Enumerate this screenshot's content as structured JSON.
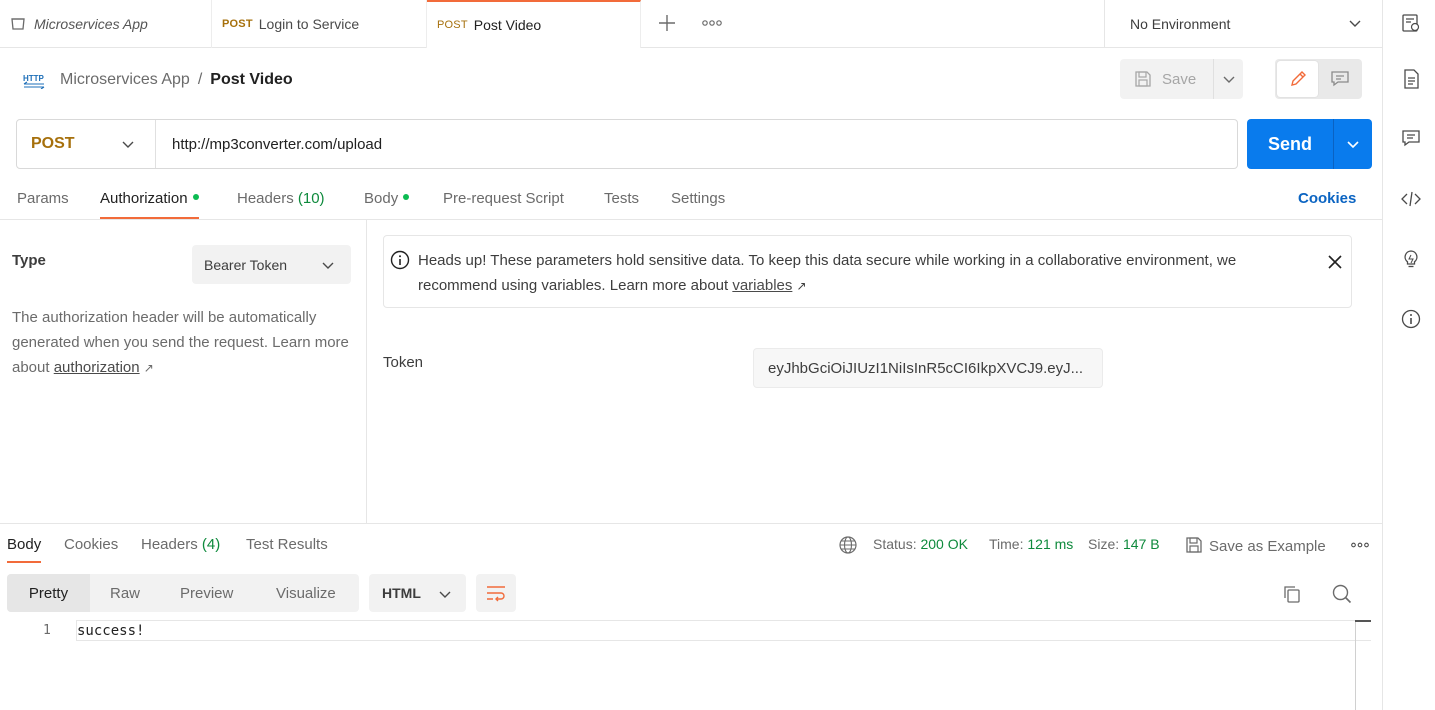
{
  "tabs": [
    {
      "method": "",
      "label": "Microservices App"
    },
    {
      "method": "POST",
      "label": "Login to Service"
    },
    {
      "method": "POST",
      "label": "Post Video"
    }
  ],
  "environment": {
    "selected": "No Environment"
  },
  "breadcrumb": {
    "collection": "Microservices App",
    "separator": "/",
    "request": "Post Video"
  },
  "toolbar": {
    "save_label": "Save"
  },
  "request": {
    "method": "POST",
    "url": "http://mp3converter.com/upload",
    "send_label": "Send"
  },
  "request_tabs": {
    "params": "Params",
    "authorization": "Authorization",
    "headers": "Headers",
    "headers_count": "(10)",
    "body": "Body",
    "prerequest": "Pre-request Script",
    "tests": "Tests",
    "settings": "Settings",
    "cookies": "Cookies"
  },
  "auth": {
    "type_label": "Type",
    "type_value": "Bearer Token",
    "desc_text": "The authorization header will be automatically generated when you send the request. Learn more about ",
    "desc_link": "authorization",
    "link_arrow": "↗",
    "notice_text": "Heads up! These parameters hold sensitive data. To keep this data secure while working in a collaborative environment, we recommend using variables. Learn more about ",
    "notice_link": "variables",
    "token_label": "Token",
    "token_value": "eyJhbGciOiJIUzI1NiIsInR5cCI6IkpXVCJ9.eyJ..."
  },
  "response": {
    "tabs": {
      "body": "Body",
      "cookies": "Cookies",
      "headers": "Headers",
      "headers_count": "(4)",
      "tests": "Test Results"
    },
    "status_label": "Status:",
    "status_value": "200 OK",
    "time_label": "Time:",
    "time_value": "121 ms",
    "size_label": "Size:",
    "size_value": "147 B",
    "save_example": "Save as Example",
    "views": [
      "Pretty",
      "Raw",
      "Preview",
      "Visualize"
    ],
    "format": "HTML",
    "line_number": "1",
    "body_text": "success!"
  },
  "colors": {
    "accent": "#f26b3a",
    "send": "#097bed",
    "method": "#a6700c",
    "ok": "#0e8a3c",
    "link": "#0b64c2"
  },
  "icons": [
    "collection-icon",
    "plus-icon",
    "more-icon",
    "chevron-down-icon",
    "http-icon",
    "save-icon",
    "pencil-icon",
    "comment-icon",
    "info-icon",
    "close-icon",
    "globe-icon",
    "copy-icon",
    "search-icon",
    "wrap-icon",
    "docs-icon",
    "code-icon",
    "bulb-icon",
    "env-icon"
  ]
}
